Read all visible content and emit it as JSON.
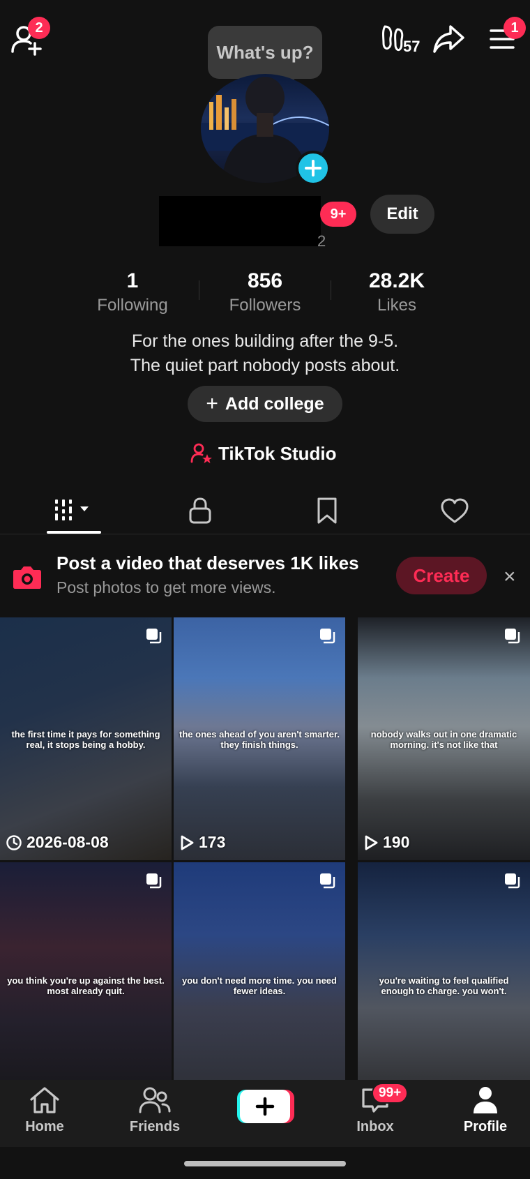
{
  "top_bar": {
    "add_friend_badge": "2",
    "bubble_text": "What's up?",
    "footprint_count": "57",
    "menu_badge": "1"
  },
  "profile": {
    "name_suffix": "2",
    "level_badge": "9+",
    "edit_label": "Edit",
    "stats": [
      {
        "value": "1",
        "label": "Following"
      },
      {
        "value": "856",
        "label": "Followers"
      },
      {
        "value": "28.2K",
        "label": "Likes"
      }
    ],
    "bio": [
      "For the ones building after the 9-5.",
      "The quiet part nobody posts about."
    ],
    "add_college_label": "Add college",
    "studio_label": "TikTok Studio"
  },
  "promo": {
    "title": "Post a video that deserves 1K likes",
    "subtitle": "Post photos to get more views.",
    "create_label": "Create",
    "close_label": "×"
  },
  "videos": [
    {
      "caption": "the first time it pays for something real, it stops being a hobby.",
      "meta": "2026-08-08",
      "meta_icon": "clock-icon"
    },
    {
      "caption": "the ones ahead of you aren't smarter. they finish things.",
      "meta": "173",
      "meta_icon": "play-icon"
    },
    {
      "caption": "nobody walks out in one dramatic morning. it's not like that",
      "meta": "190",
      "meta_icon": "play-icon"
    },
    {
      "caption": "you think you're up against the best. most already quit.",
      "meta": "",
      "meta_icon": ""
    },
    {
      "caption": "you don't need more time. you need fewer ideas.",
      "meta": "",
      "meta_icon": ""
    },
    {
      "caption": "you're waiting to feel qualified enough to charge. you won't.",
      "meta": "",
      "meta_icon": ""
    }
  ],
  "bottom_nav": {
    "home": "Home",
    "friends": "Friends",
    "inbox": "Inbox",
    "inbox_badge": "99+",
    "profile": "Profile"
  },
  "colors": {
    "background": "#121212",
    "accent": "#fe2c55",
    "cyan": "#20c3e6"
  }
}
